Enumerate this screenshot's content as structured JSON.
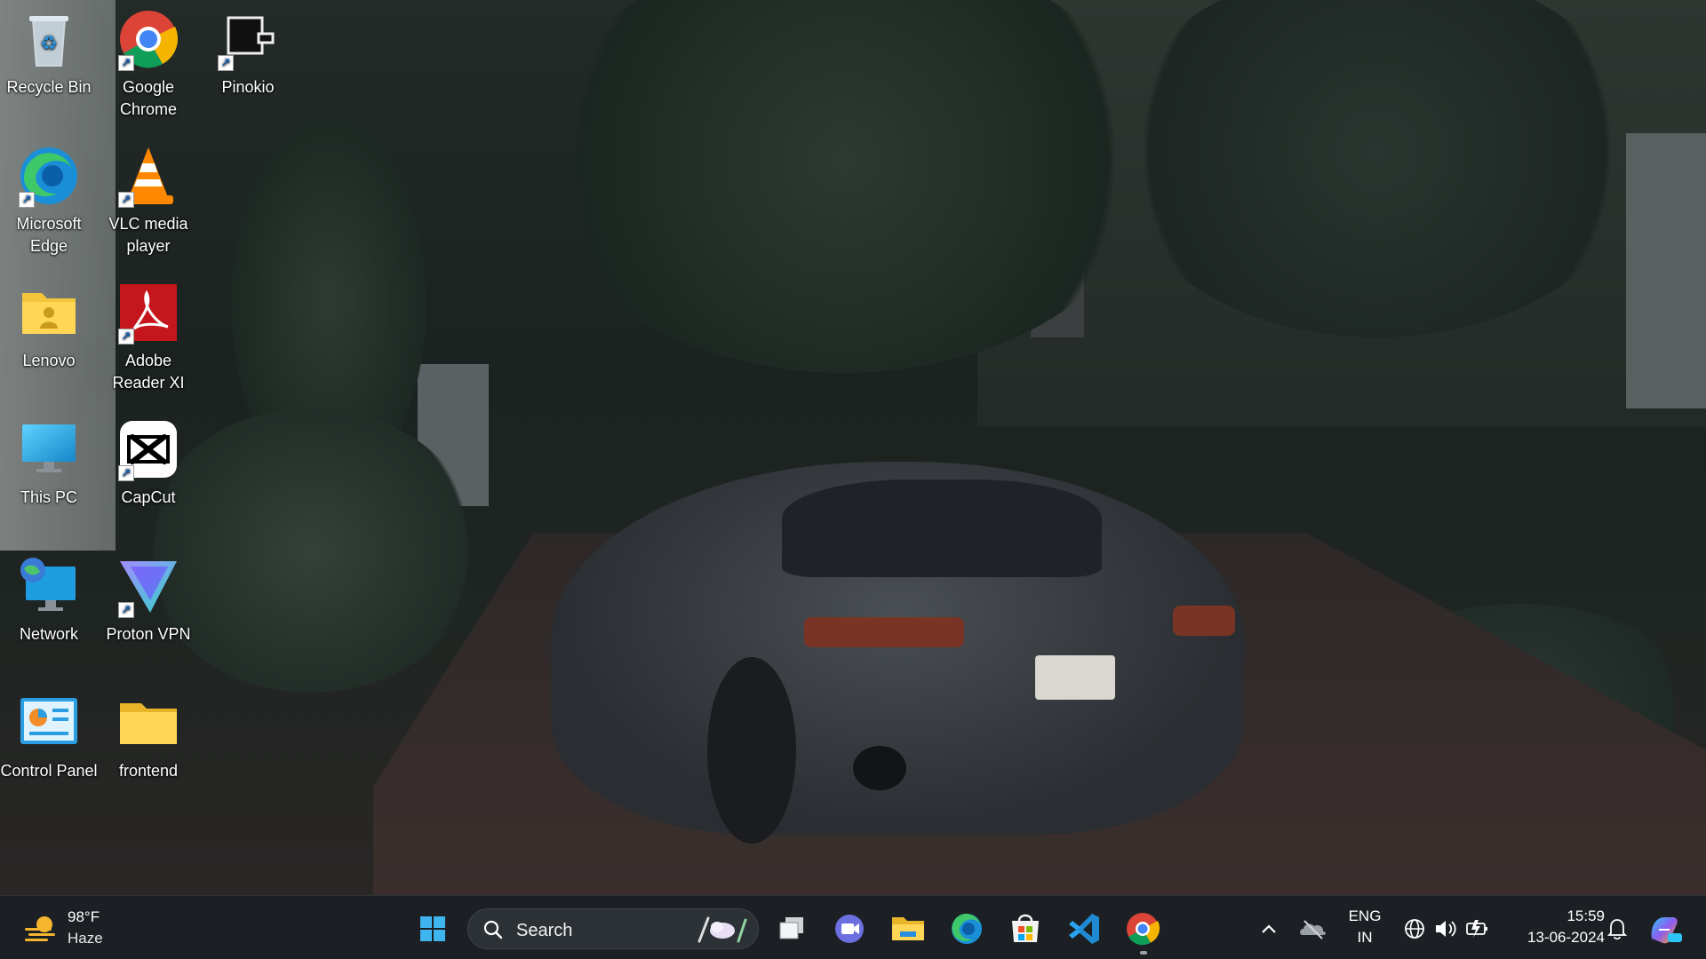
{
  "desktop": {
    "icons": [
      {
        "label": "Recycle Bin"
      },
      {
        "label": "Google Chrome"
      },
      {
        "label": "Pinokio"
      },
      {
        "label": "Microsoft Edge"
      },
      {
        "label": "VLC media player"
      },
      {
        "label": "Lenovo"
      },
      {
        "label": "Adobe Reader XI"
      },
      {
        "label": "This PC"
      },
      {
        "label": "CapCut"
      },
      {
        "label": "Network"
      },
      {
        "label": "Proton VPN"
      },
      {
        "label": "Control Panel"
      },
      {
        "label": "frontend"
      }
    ]
  },
  "taskbar": {
    "weather": {
      "temp": "98°F",
      "condition": "Haze"
    },
    "search": {
      "label": "Search"
    },
    "tray": {
      "language_top": "ENG",
      "language_bottom": "IN",
      "time": "15:59",
      "date": "13-06-2024"
    }
  },
  "colors": {
    "taskbar_bg": "#1c2024",
    "accent": "#0078d4"
  }
}
